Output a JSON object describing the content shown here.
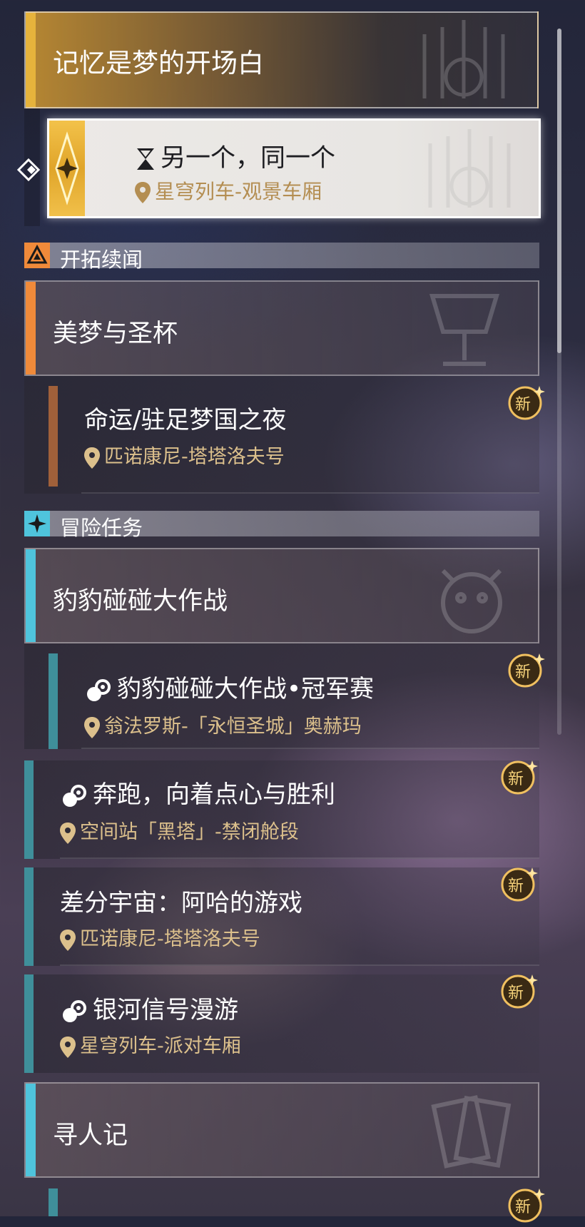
{
  "main_quest": {
    "title": "记忆是梦的开场白",
    "selected_quest": {
      "title": "另一个，同一个",
      "location": "星穹列车-观景车厢"
    }
  },
  "sections": {
    "trailblaze_continuance": {
      "label": "开拓续闻",
      "group_title": "美梦与圣杯",
      "quests": [
        {
          "title": "命运/驻足梦国之夜",
          "location": "匹诺康尼-塔塔洛夫号",
          "badge": "新"
        }
      ]
    },
    "adventure": {
      "label": "冒险任务",
      "group_title": "豹豹碰碰大作战",
      "quests": [
        {
          "title": "豹豹碰碰大作战•冠军赛",
          "location": "翁法罗斯-「永恒圣城」奥赫玛",
          "badge": "新"
        },
        {
          "title": "奔跑，向着点心与胜利",
          "location": "空间站「黑塔」-禁闭舱段",
          "badge": "新"
        },
        {
          "title": "差分宇宙：阿哈的游戏",
          "location": "匹诺康尼-塔塔洛夫号",
          "badge": "新"
        },
        {
          "title": "银河信号漫游",
          "location": "星穹列车-派对车厢",
          "badge": "新"
        }
      ],
      "group_title_2": "寻人记",
      "trailing_badge": "新"
    }
  },
  "colors": {
    "gold": "#e6b33c",
    "orange": "#f08a3a",
    "cyan": "#4fc4dc",
    "teal_bar": "#3f8f9a",
    "brown_bar": "#a0603a",
    "badge": "#d9a23c"
  }
}
